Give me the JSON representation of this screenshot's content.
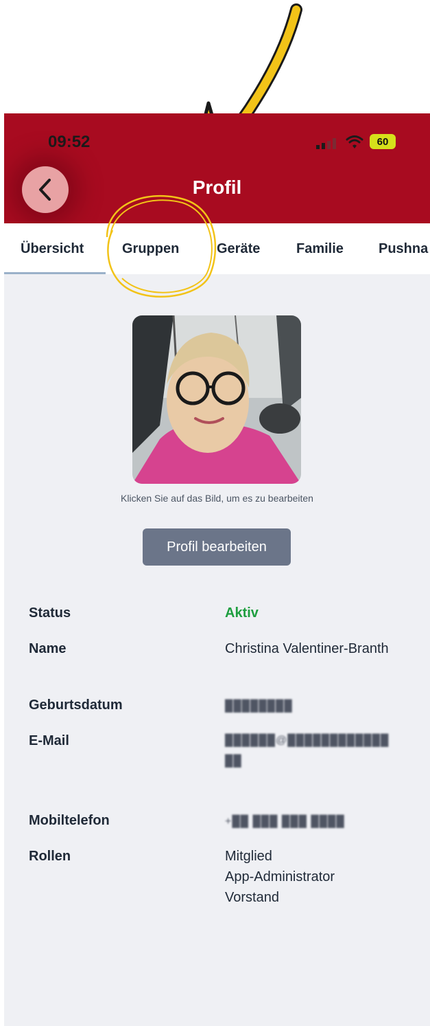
{
  "status_bar": {
    "time": "09:52",
    "battery": "60"
  },
  "header": {
    "title": "Profil"
  },
  "tabs": [
    {
      "label": "Übersicht"
    },
    {
      "label": "Gruppen"
    },
    {
      "label": "Geräte"
    },
    {
      "label": "Familie"
    },
    {
      "label": "Pushna"
    }
  ],
  "profile": {
    "photo_hint": "Klicken Sie auf das Bild, um es zu bearbeiten",
    "edit_button": "Profil bearbeiten"
  },
  "details": {
    "status": {
      "label": "Status",
      "value": "Aktiv"
    },
    "name": {
      "label": "Name",
      "value": "Christina Valentiner-Branth"
    },
    "birthdate": {
      "label": "Geburtsdatum",
      "value": "████████"
    },
    "email": {
      "label": "E-Mail",
      "value": "██████@██████████████"
    },
    "mobile": {
      "label": "Mobiltelefon",
      "value": "+██ ███ ███ ████"
    },
    "roles": {
      "label": "Rollen",
      "values": [
        "Mitglied",
        "App-Administrator",
        "Vorstand"
      ]
    }
  },
  "colors": {
    "header": "#a80b20",
    "accent_green": "#1e9e3f",
    "button": "#6b7589",
    "annotation": "#f2c318"
  }
}
